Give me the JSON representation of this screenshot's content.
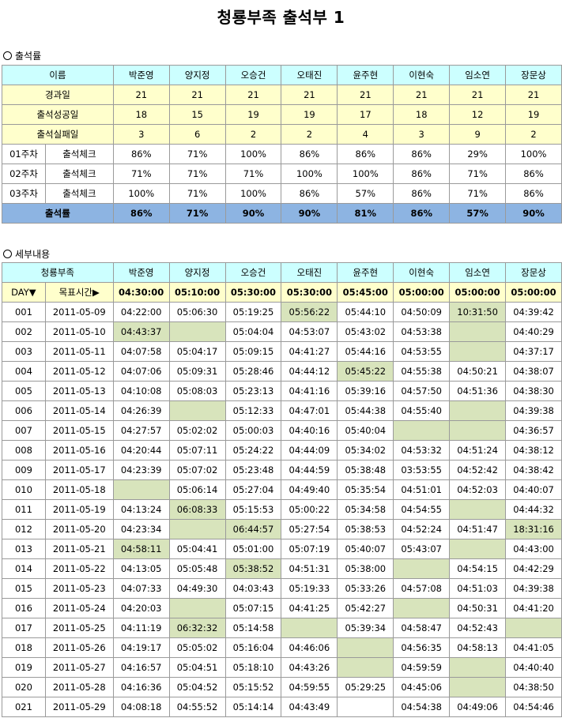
{
  "title": "청룡부족 출석부 1",
  "section1": {
    "label": "출석률",
    "name_header": "이름",
    "names": [
      "박준영",
      "양지정",
      "오승건",
      "오태진",
      "윤주현",
      "이현숙",
      "임소연",
      "장문상"
    ],
    "rows": [
      {
        "label": "경과일",
        "values": [
          "21",
          "21",
          "21",
          "21",
          "21",
          "21",
          "21",
          "21"
        ]
      },
      {
        "label": "출석성공일",
        "values": [
          "18",
          "15",
          "19",
          "19",
          "17",
          "18",
          "12",
          "19"
        ]
      },
      {
        "label": "출석실패일",
        "values": [
          "3",
          "6",
          "2",
          "2",
          "4",
          "3",
          "9",
          "2"
        ]
      }
    ],
    "weeks": [
      {
        "week": "01주차",
        "label": "출석체크",
        "values": [
          "86%",
          "71%",
          "100%",
          "86%",
          "86%",
          "86%",
          "29%",
          "100%"
        ]
      },
      {
        "week": "02주차",
        "label": "출석체크",
        "values": [
          "71%",
          "71%",
          "71%",
          "100%",
          "100%",
          "86%",
          "71%",
          "86%"
        ]
      },
      {
        "week": "03주차",
        "label": "출석체크",
        "values": [
          "100%",
          "71%",
          "100%",
          "86%",
          "57%",
          "86%",
          "71%",
          "86%"
        ]
      }
    ],
    "total": {
      "label": "출석률",
      "values": [
        "86%",
        "71%",
        "90%",
        "90%",
        "81%",
        "86%",
        "57%",
        "90%"
      ]
    }
  },
  "section2": {
    "label": "세부내용",
    "group_header": "청룡부족",
    "names": [
      "박준영",
      "양지정",
      "오승건",
      "오태진",
      "윤주현",
      "이현숙",
      "임소연",
      "장문상"
    ],
    "day_header": "DAY▼",
    "target_label": "목표시간▶",
    "targets": [
      "04:30:00",
      "05:10:00",
      "05:30:00",
      "05:30:00",
      "05:45:00",
      "05:00:00",
      "05:00:00",
      "05:00:00"
    ],
    "days": [
      {
        "day": "001",
        "date": "2011-05-09",
        "times": [
          "04:22:00",
          "05:06:30",
          "05:19:25",
          "05:56:22",
          "05:44:10",
          "04:50:09",
          "10:31:50",
          "04:39:42"
        ],
        "flags": [
          0,
          0,
          0,
          1,
          0,
          0,
          1,
          0
        ]
      },
      {
        "day": "002",
        "date": "2011-05-10",
        "times": [
          "04:43:37",
          "",
          "05:04:04",
          "04:53:07",
          "05:43:02",
          "04:53:38",
          "",
          "04:40:29"
        ],
        "flags": [
          1,
          1,
          0,
          0,
          0,
          0,
          1,
          0
        ]
      },
      {
        "day": "003",
        "date": "2011-05-11",
        "times": [
          "04:07:58",
          "05:04:17",
          "05:09:15",
          "04:41:27",
          "05:44:16",
          "04:53:55",
          "",
          "04:37:17"
        ],
        "flags": [
          0,
          0,
          0,
          0,
          0,
          0,
          1,
          0
        ]
      },
      {
        "day": "004",
        "date": "2011-05-12",
        "times": [
          "04:07:06",
          "05:09:31",
          "05:28:46",
          "04:44:12",
          "05:45:22",
          "04:55:38",
          "04:50:21",
          "04:38:07"
        ],
        "flags": [
          0,
          0,
          0,
          0,
          1,
          0,
          0,
          0
        ]
      },
      {
        "day": "005",
        "date": "2011-05-13",
        "times": [
          "04:10:08",
          "05:08:03",
          "05:23:13",
          "04:41:16",
          "05:39:16",
          "04:57:50",
          "04:51:36",
          "04:38:30"
        ],
        "flags": [
          0,
          0,
          0,
          0,
          0,
          0,
          0,
          0
        ]
      },
      {
        "day": "006",
        "date": "2011-05-14",
        "times": [
          "04:26:39",
          "",
          "05:12:33",
          "04:47:01",
          "05:44:38",
          "04:55:40",
          "",
          "04:39:38"
        ],
        "flags": [
          0,
          1,
          0,
          0,
          0,
          0,
          1,
          0
        ]
      },
      {
        "day": "007",
        "date": "2011-05-15",
        "times": [
          "04:27:57",
          "05:02:02",
          "05:00:03",
          "04:40:16",
          "05:40:04",
          "",
          "",
          "04:36:57"
        ],
        "flags": [
          0,
          0,
          0,
          0,
          0,
          1,
          1,
          0
        ]
      },
      {
        "day": "008",
        "date": "2011-05-16",
        "times": [
          "04:20:44",
          "05:07:11",
          "05:24:22",
          "04:44:09",
          "05:34:02",
          "04:53:32",
          "04:51:24",
          "04:38:12"
        ],
        "flags": [
          0,
          0,
          0,
          0,
          0,
          0,
          0,
          0
        ]
      },
      {
        "day": "009",
        "date": "2011-05-17",
        "times": [
          "04:23:39",
          "05:07:02",
          "05:23:48",
          "04:44:59",
          "05:38:48",
          "03:53:55",
          "04:52:42",
          "04:38:42"
        ],
        "flags": [
          0,
          0,
          0,
          0,
          0,
          0,
          0,
          0
        ]
      },
      {
        "day": "010",
        "date": "2011-05-18",
        "times": [
          "",
          "05:06:14",
          "05:27:04",
          "04:49:40",
          "05:35:54",
          "04:51:01",
          "04:52:03",
          "04:40:07"
        ],
        "flags": [
          1,
          0,
          0,
          0,
          0,
          0,
          0,
          0
        ]
      },
      {
        "day": "011",
        "date": "2011-05-19",
        "times": [
          "04:13:24",
          "06:08:33",
          "05:15:53",
          "05:00:22",
          "05:34:58",
          "04:54:55",
          "",
          "04:44:32"
        ],
        "flags": [
          0,
          1,
          0,
          0,
          0,
          0,
          1,
          0
        ]
      },
      {
        "day": "012",
        "date": "2011-05-20",
        "times": [
          "04:23:34",
          "",
          "06:44:57",
          "05:27:54",
          "05:38:53",
          "04:52:24",
          "04:51:47",
          "18:31:16"
        ],
        "flags": [
          0,
          1,
          1,
          0,
          0,
          0,
          0,
          1
        ]
      },
      {
        "day": "013",
        "date": "2011-05-21",
        "times": [
          "04:58:11",
          "05:04:41",
          "05:01:00",
          "05:07:19",
          "05:40:07",
          "05:43:07",
          "",
          "04:43:00"
        ],
        "flags": [
          1,
          0,
          0,
          0,
          0,
          0,
          1,
          0
        ]
      },
      {
        "day": "014",
        "date": "2011-05-22",
        "times": [
          "04:13:05",
          "05:05:48",
          "05:38:52",
          "04:51:31",
          "05:38:00",
          "",
          "04:54:15",
          "04:42:29"
        ],
        "flags": [
          0,
          0,
          1,
          0,
          0,
          1,
          0,
          0
        ]
      },
      {
        "day": "015",
        "date": "2011-05-23",
        "times": [
          "04:07:33",
          "04:49:30",
          "04:03:43",
          "05:19:33",
          "05:33:26",
          "04:57:08",
          "04:51:03",
          "04:39:38"
        ],
        "flags": [
          0,
          0,
          0,
          0,
          0,
          0,
          0,
          0
        ]
      },
      {
        "day": "016",
        "date": "2011-05-24",
        "times": [
          "04:20:03",
          "",
          "05:07:15",
          "04:41:25",
          "05:42:27",
          "",
          "04:50:31",
          "04:41:20"
        ],
        "flags": [
          0,
          1,
          0,
          0,
          0,
          1,
          0,
          0
        ]
      },
      {
        "day": "017",
        "date": "2011-05-25",
        "times": [
          "04:11:19",
          "06:32:32",
          "05:14:58",
          "",
          "05:39:34",
          "04:58:47",
          "04:52:43",
          ""
        ],
        "flags": [
          0,
          1,
          0,
          1,
          0,
          0,
          0,
          1
        ]
      },
      {
        "day": "018",
        "date": "2011-05-26",
        "times": [
          "04:19:17",
          "05:05:02",
          "05:16:04",
          "04:46:06",
          "",
          "04:56:35",
          "04:58:13",
          "04:41:05"
        ],
        "flags": [
          0,
          0,
          0,
          0,
          1,
          0,
          0,
          0
        ]
      },
      {
        "day": "019",
        "date": "2011-05-27",
        "times": [
          "04:16:57",
          "05:04:51",
          "05:18:10",
          "04:43:26",
          "",
          "04:59:59",
          "",
          "04:40:40"
        ],
        "flags": [
          0,
          0,
          0,
          0,
          1,
          0,
          1,
          0
        ]
      },
      {
        "day": "020",
        "date": "2011-05-28",
        "times": [
          "04:16:36",
          "05:04:52",
          "05:15:52",
          "04:59:55",
          "05:29:25",
          "04:45:06",
          "",
          "04:38:50"
        ],
        "flags": [
          0,
          0,
          0,
          0,
          0,
          0,
          1,
          0
        ]
      },
      {
        "day": "021",
        "date": "2011-05-29",
        "times": [
          "04:08:18",
          "04:55:52",
          "05:14:14",
          "04:43:49",
          "",
          "04:54:38",
          "04:49:06",
          "04:54:46"
        ],
        "flags": [
          0,
          0,
          0,
          0,
          0,
          0,
          0,
          0
        ]
      }
    ]
  },
  "colors": {
    "header_cyan": "#ccffff",
    "header_yellow": "#ffffcc",
    "total_blue": "#8db4e2",
    "highlight_green": "#d8e4bc"
  }
}
